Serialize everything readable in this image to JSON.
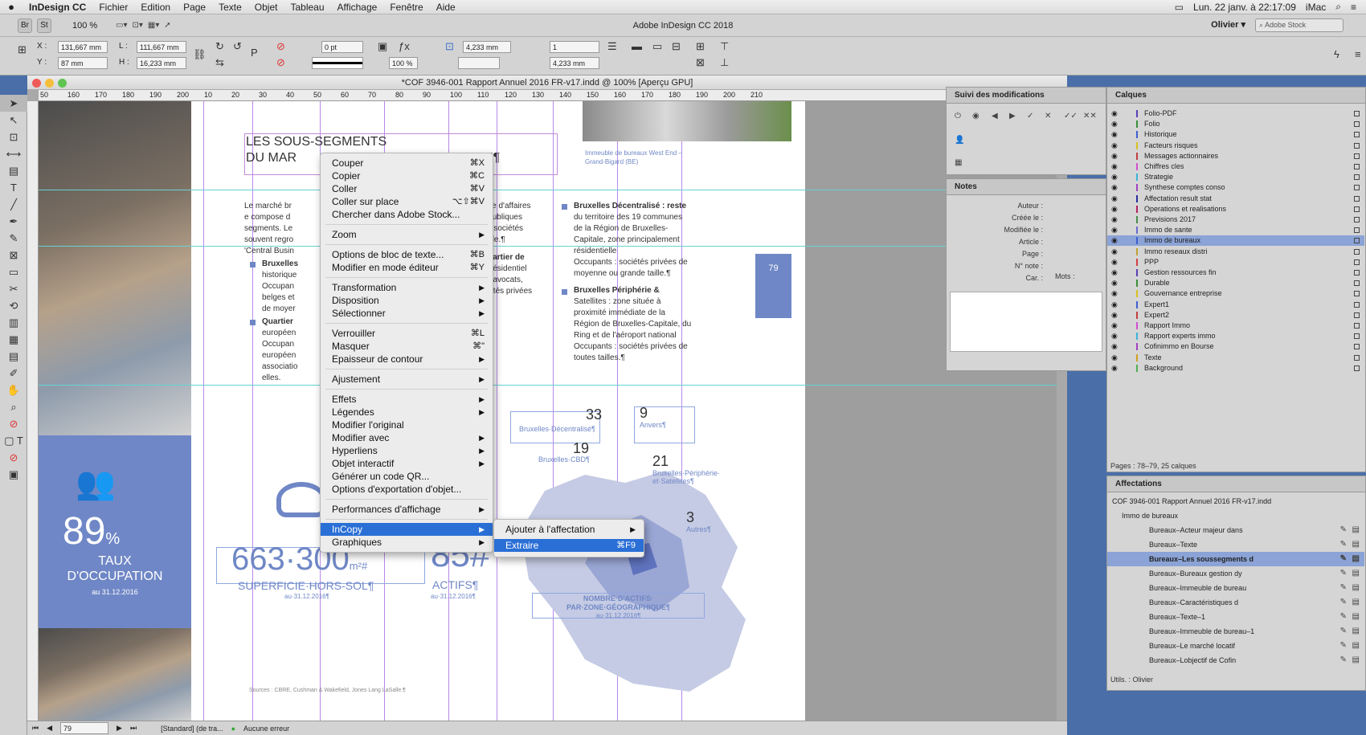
{
  "menubar": {
    "apple": "",
    "app": "InDesign CC",
    "items": [
      "Fichier",
      "Edition",
      "Page",
      "Texte",
      "Objet",
      "Tableau",
      "Affichage",
      "Fenêtre",
      "Aide"
    ],
    "clock": "Lun. 22 janv. à  22:17:09",
    "machine": "iMac"
  },
  "appbar": {
    "title": "Adobe InDesign CC 2018",
    "zoom": "100 %",
    "workspace": "Olivier",
    "stock_placeholder": "Adobe Stock",
    "br": "Br",
    "st": "St"
  },
  "control": {
    "x": "131,667 mm",
    "y": "87 mm",
    "w": "111,667 mm",
    "h": "16,233 mm",
    "stroke": "0 pt",
    "scale": "100 %",
    "fw": "4,233 mm",
    "fh": "4,233 mm",
    "cols": "1",
    "labels": {
      "x": "X :",
      "y": "Y :",
      "w": "L :",
      "h": "H :"
    }
  },
  "document": {
    "title": "*COF 3946-001 Rapport Annuel 2016 FR-v17.indd @ 100% [Aperçu GPU]",
    "ruler": [
      "50",
      "160",
      "170",
      "180",
      "190",
      "200",
      "10",
      "20",
      "30",
      "40",
      "50",
      "60",
      "70",
      "80",
      "90",
      "100",
      "110",
      "120",
      "130",
      "140",
      "150",
      "160",
      "170",
      "180",
      "190",
      "200",
      "210"
    ],
    "page_field": "79",
    "style": "[Standard] (de tra...",
    "errors": "Aucune erreur"
  },
  "page": {
    "heading_1": "LES SOUS-SEGMENTS",
    "heading_2": "DU MAR",
    "heading_tail": "EAUX¶",
    "stat_value": "89",
    "stat_unit": "%",
    "stat_label_1": "TAUX",
    "stat_label_2": "D'OCCUPATION",
    "stat_date": "au 31.12.2016",
    "big_num": "663·300",
    "big_unit": "m²#",
    "big_label": "SUPERFICIE·HORS-SOL¶",
    "big_date": "au·31.12.2016¶",
    "actifs_num": "85#",
    "actifs_label": "ACTIFS¶",
    "actifs_date": "au·31.12.2016¶",
    "page_number": "79",
    "photo_caption_1": "Immeuble de bureaux West End –",
    "photo_caption_2": "Grand-Bigard (BE)",
    "col1_lines": [
      "Le marché br",
      "e compose d",
      "segments. Le",
      "souvent regro",
      "'Central Busin"
    ],
    "col1_b1": "Bruxelles",
    "col1_b1_lines": [
      "historique",
      "Occupan",
      "belges et",
      "de moyer"
    ],
    "col1_b2": "Quartier",
    "col1_b2_lines": [
      "européen",
      "Occupan",
      "européen",
      "associatio",
      "elles."
    ],
    "col2_lines": [
      "Nord : zone d'affaires",
      "autorités publiques",
      "égionales, sociétés",
      "grande taille.¶"
    ],
    "col2_b": "ouise : quartier de",
    "col2_b_lines": [
      "ne mixte (résidentiel",
      "cabinets d'avocats,",
      "és et sociétés privées",
      "yenne.¶"
    ],
    "col3_b1": "Bruxelles Décentralisé : reste",
    "col3_b1_lines": [
      "du territoire des 19 communes",
      "de la Région de Bruxelles-",
      "Capitale, zone principalement",
      "résidentielle",
      "Occupants : sociétés privées de",
      "moyenne ou grande taille.¶"
    ],
    "col3_b2": "Bruxelles Périphérie &",
    "col3_b2_title2": "Satellites : zone située à",
    "col3_b2_lines": [
      "proximité immédiate de la",
      "Région de Bruxelles-Capitale, du",
      "Ring et de l'aéroport national",
      "Occupants : sociétés privées de",
      "toutes tailles.¶"
    ],
    "map_labels": [
      {
        "num": "33",
        "label": "Bruxelles·Décentralisé¶"
      },
      {
        "num": "19",
        "label": "Bruxelles·CBD¶"
      },
      {
        "num": "9",
        "label": "Anvers¶"
      },
      {
        "num": "21",
        "label": "Bruxelles·Périphérie· et·Satellites¶"
      },
      {
        "num": "3",
        "label": "Autres¶"
      }
    ],
    "map_title_1": "NOMBRE·D'ACTIFS·",
    "map_title_2": "PAR·ZONE·GÉOGRAPHIQUE¶",
    "map_date": "au·31.12.2016¶",
    "sources": "Sources : CBRE, Cushman & Wakefield, Jones Lang LaSalle.¶"
  },
  "context_menu": [
    {
      "label": "Couper",
      "sc": "⌘X"
    },
    {
      "label": "Copier",
      "sc": "⌘C"
    },
    {
      "label": "Coller",
      "sc": "⌘V"
    },
    {
      "label": "Coller sur place",
      "sc": "⌥⇧⌘V"
    },
    {
      "label": "Chercher dans Adobe Stock...",
      "sc": ""
    },
    {
      "label": "Zoom",
      "sub": true
    },
    {
      "label": "Options de bloc de texte...",
      "sc": "⌘B"
    },
    {
      "label": "Modifier en mode éditeur",
      "sc": "⌘Y"
    },
    {
      "label": "Transformation",
      "sub": true
    },
    {
      "label": "Disposition",
      "sub": true
    },
    {
      "label": "Sélectionner",
      "sub": true
    },
    {
      "label": "Verrouiller",
      "sc": "⌘L"
    },
    {
      "label": "Masquer",
      "sc": "⌘\""
    },
    {
      "label": "Epaisseur de contour",
      "sub": true
    },
    {
      "label": "Ajustement",
      "sub": true
    },
    {
      "label": "Effets",
      "sub": true
    },
    {
      "label": "Légendes",
      "sub": true
    },
    {
      "label": "Modifier l'original",
      "sc": ""
    },
    {
      "label": "Modifier avec",
      "sub": true
    },
    {
      "label": "Hyperliens",
      "sub": true
    },
    {
      "label": "Objet interactif",
      "sub": true
    },
    {
      "label": "Générer un code QR...",
      "sc": ""
    },
    {
      "label": "Options d'exportation d'objet...",
      "sc": ""
    },
    {
      "label": "Performances d'affichage",
      "sub": true
    },
    {
      "label": "InCopy",
      "sub": true
    },
    {
      "label": "Graphiques",
      "sub": true
    }
  ],
  "submenu": [
    {
      "label": "Ajouter à l'affectation",
      "sub": true
    },
    {
      "label": "Extraire",
      "sc": "⌘F9"
    }
  ],
  "panels": {
    "track": "Suivi des modifications",
    "notes": "Notes",
    "notes_fields": [
      "Auteur :",
      "Créée le :",
      "Modifiée le :",
      "Article :",
      "Page :",
      "N° note :",
      "Car. :",
      "Mots :"
    ],
    "layers": "Calques",
    "layers_items": [
      {
        "name": "Folio-PDF",
        "color": "#5a3fb5"
      },
      {
        "name": "Folio",
        "color": "#3a8f3a"
      },
      {
        "name": "Historique",
        "color": "#3c5fd0"
      },
      {
        "name": "Facteurs risques",
        "color": "#d8c020"
      },
      {
        "name": "Messages actionnaires",
        "color": "#c23f3f"
      },
      {
        "name": "Chiffres cles",
        "color": "#d34fd3"
      },
      {
        "name": "Strategie",
        "color": "#3ab1d8"
      },
      {
        "name": "Synthese comptes conso",
        "color": "#a040c0"
      },
      {
        "name": "Affectation result stat",
        "color": "#2a2aa0"
      },
      {
        "name": "Operations et realisations",
        "color": "#b02060"
      },
      {
        "name": "Previsions 2017",
        "color": "#4a8a4a"
      },
      {
        "name": "Immo de sante",
        "color": "#6a6ad0"
      },
      {
        "name": "Immo de bureaux",
        "color": "#3c5fd0",
        "selected": true
      },
      {
        "name": "Immo reseaux distri",
        "color": "#c0a030"
      },
      {
        "name": "PPP",
        "color": "#d04040"
      },
      {
        "name": "Gestion ressources fin",
        "color": "#5a3fb5"
      },
      {
        "name": "Durable",
        "color": "#3a8f3a"
      },
      {
        "name": "Gouvernance entreprise",
        "color": "#d8c020"
      },
      {
        "name": "Expert1",
        "color": "#3c5fd0"
      },
      {
        "name": "Expert2",
        "color": "#c23f3f"
      },
      {
        "name": "Rapport Immo",
        "color": "#d34fd3"
      },
      {
        "name": "Rapport experts immo",
        "color": "#3ab1d8"
      },
      {
        "name": "Cofinimmo en Bourse",
        "color": "#a040c0"
      },
      {
        "name": "Texte",
        "color": "#d0a020"
      },
      {
        "name": "Background",
        "color": "#50b050"
      }
    ],
    "layers_footer": "Pages : 78–79, 25 calques",
    "assign": "Affectations",
    "assign_items": [
      {
        "name": "COF 3946-001 Rapport Annuel 2016 FR-v17.indd",
        "level": 0
      },
      {
        "name": "Immo de bureaux",
        "level": 1
      },
      {
        "name": "Bureaux–Acteur majeur dans",
        "level": 2
      },
      {
        "name": "Bureaux–Texte",
        "level": 2
      },
      {
        "name": "Bureaux–Les soussegments d",
        "level": 2,
        "selected": true
      },
      {
        "name": "Bureaux–Bureaux gestion dy",
        "level": 2
      },
      {
        "name": "Bureaux–Immeuble de bureau",
        "level": 2
      },
      {
        "name": "Bureaux–Caractéristiques d",
        "level": 2
      },
      {
        "name": "Bureaux–Texte–1",
        "level": 2
      },
      {
        "name": "Bureaux–Immeuble de bureau–1",
        "level": 2
      },
      {
        "name": "Bureaux–Le marché locatif",
        "level": 2
      },
      {
        "name": "Bureaux–Lobjectif de Cofin",
        "level": 2
      }
    ],
    "assign_footer": "Utils. : Olivier"
  },
  "colors": {
    "accent": "#6f87c6",
    "highlight": "#2a6fd6",
    "guide_v": "#b88ae8",
    "guide_h": "#65d3d3"
  }
}
